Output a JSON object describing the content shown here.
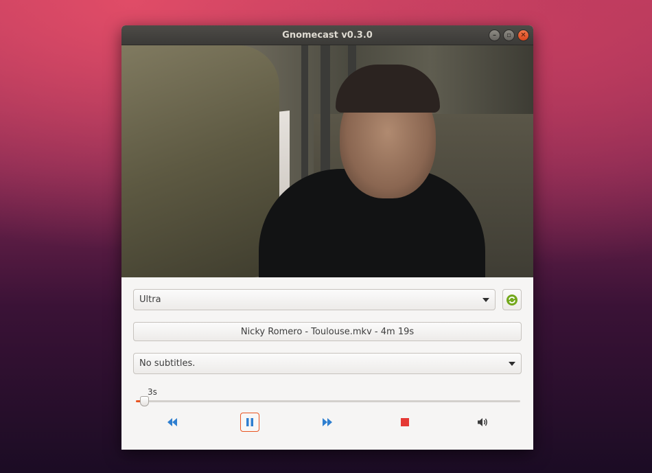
{
  "window": {
    "title": "Gnomecast v0.3.0"
  },
  "colors": {
    "accent": "#e95420",
    "transport_blue": "#2f7fd0",
    "stop_red": "#e53935",
    "refresh_green": "#73a81c"
  },
  "device": {
    "selected": "Ultra",
    "refresh_icon": "refresh-icon"
  },
  "file": {
    "name": "Nicky Romero - Toulouse.mkv",
    "separator": " - ",
    "duration": "4m 19s"
  },
  "subtitles": {
    "selected": "No subtitles."
  },
  "seek": {
    "value_label": "3s",
    "position_seconds": 3,
    "duration_seconds": 259
  },
  "transport": {
    "rewind_icon": "rewind-icon",
    "pause_icon": "pause-icon",
    "forward_icon": "fast-forward-icon",
    "stop_icon": "stop-icon",
    "volume_icon": "volume-icon"
  }
}
